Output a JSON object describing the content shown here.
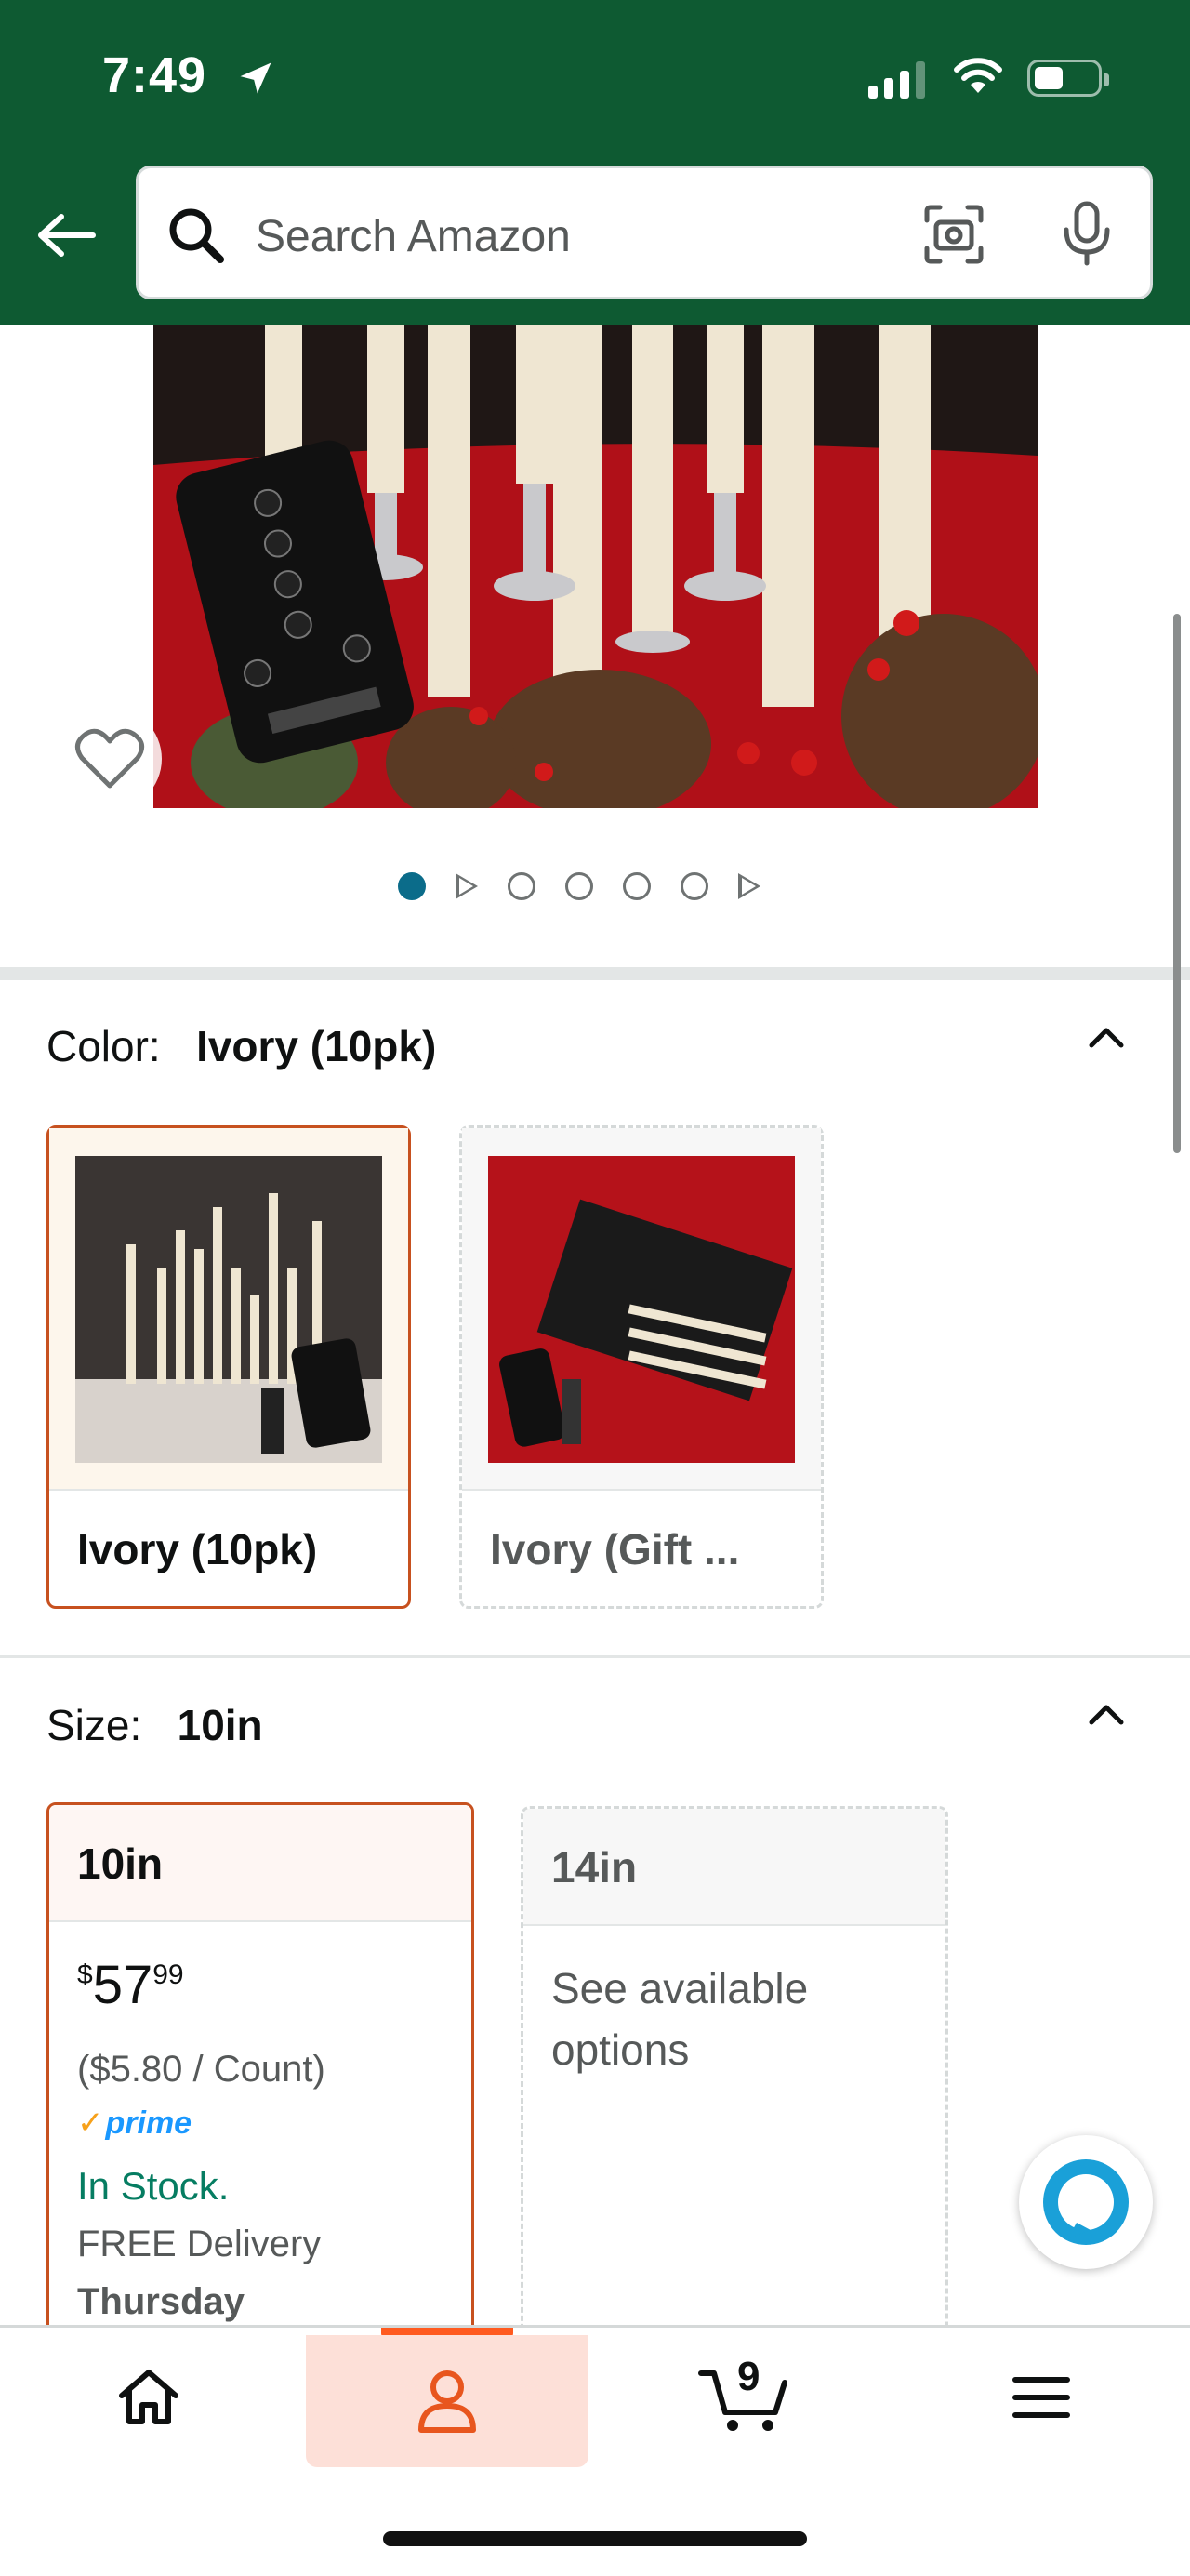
{
  "status_bar": {
    "time": "7:49"
  },
  "search": {
    "placeholder": "Search Amazon"
  },
  "product_image": {
    "carousel": {
      "total_items": 7,
      "active_index": 0,
      "video_positions": [
        1,
        6
      ]
    }
  },
  "color": {
    "label": "Color:",
    "selected_value": "Ivory (10pk)",
    "options": [
      {
        "label": "Ivory (10pk)",
        "selected": true
      },
      {
        "label": "Ivory (Gift ...",
        "selected": false
      }
    ]
  },
  "size": {
    "label": "Size:",
    "selected_value": "10in",
    "options": [
      {
        "label": "10in",
        "selected": true,
        "price_symbol": "$",
        "price_whole": "57",
        "price_fraction": "99",
        "unit_price": "($5.80 / Count)",
        "prime": "prime",
        "stock": "In Stock.",
        "delivery": "FREE Delivery",
        "delivery_day": "Thursday"
      },
      {
        "label": "14in",
        "selected": false,
        "note": "See available options"
      }
    ]
  },
  "bottom_nav": {
    "cart_count": "9",
    "active": "account"
  },
  "colors": {
    "header_bg": "#0e5a32",
    "selected_border": "#c7511f",
    "in_stock": "#067d62",
    "active_nav": "#ff5a1f",
    "dot_active": "#0b6c8a"
  }
}
